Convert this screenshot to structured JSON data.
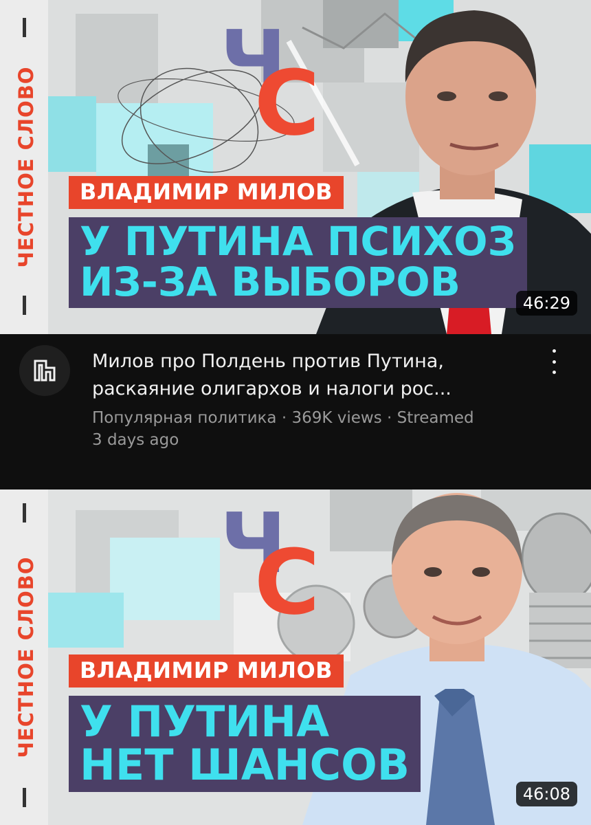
{
  "videos": [
    {
      "thumbnail": {
        "side_text": "ЧЕСТНОЕ СЛОВО",
        "logo_ch": "Ч",
        "logo_s": "С",
        "name_tag": "ВЛАДИМИР МИЛОВ",
        "headline_lines": [
          "У ПУТИНА ПСИХОЗ",
          "ИЗ-ЗА ВЫБОРОВ"
        ],
        "duration": "46:29"
      },
      "title_lines": [
        "Милов про Полдень против Путина,",
        "раскаяние олигархов и налоги рос..."
      ],
      "subtitle_lines": [
        "Популярная политика · 369K views · Streamed",
        "3 days ago"
      ],
      "channel_icon": "channel-logo-icon",
      "menu_icon": "more-vert-icon"
    },
    {
      "thumbnail": {
        "side_text": "ЧЕСТНОЕ СЛОВО",
        "logo_ch": "Ч",
        "logo_s": "С",
        "name_tag": "ВЛАДИМИР МИЛОВ",
        "headline_lines": [
          "У ПУТИНА",
          "НЕТ ШАНСОВ"
        ],
        "duration": "46:08"
      }
    }
  ],
  "colors": {
    "brand_red": "#e8452b",
    "headline_bg": "#4b3f66",
    "headline_text": "#3fe0ee",
    "background": "#0f0f0f"
  }
}
